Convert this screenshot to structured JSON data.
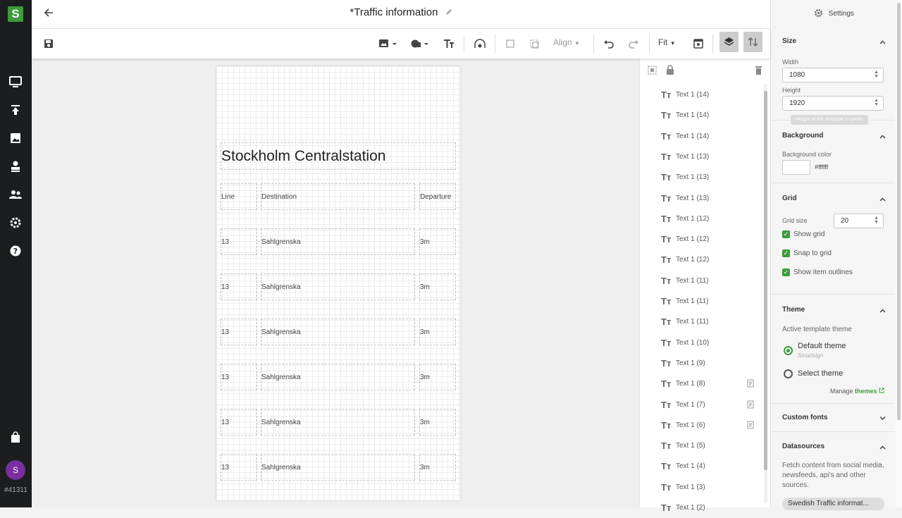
{
  "app": {
    "logo": "S",
    "user_initial": "S",
    "user_id": "#41311"
  },
  "header": {
    "title": "*Traffic information"
  },
  "toolbar": {
    "align_label": "Align",
    "zoom_label": "Fit"
  },
  "canvas": {
    "station": "Stockholm Centralstation",
    "headers": {
      "line": "Line",
      "destination": "Destination",
      "departure": "Departure"
    },
    "rows": [
      {
        "line": "13",
        "destination": "Sahlgrenska",
        "departure": "3m"
      },
      {
        "line": "13",
        "destination": "Sahlgrenska",
        "departure": "3m"
      },
      {
        "line": "13",
        "destination": "Sahlgrenska",
        "departure": "3m"
      },
      {
        "line": "13",
        "destination": "Sahlgrenska",
        "departure": "3m"
      },
      {
        "line": "13",
        "destination": "Sahlgrenska",
        "departure": "3m"
      },
      {
        "line": "13",
        "destination": "Sahlgrenska",
        "departure": "3m"
      }
    ]
  },
  "layers": {
    "glyph": "Tт",
    "items": [
      {
        "label": "Text 1 (14)"
      },
      {
        "label": "Text 1 (14)"
      },
      {
        "label": "Text 1 (14)"
      },
      {
        "label": "Text 1 (13)"
      },
      {
        "label": "Text 1 (13)"
      },
      {
        "label": "Text 1 (13)"
      },
      {
        "label": "Text 1 (12)"
      },
      {
        "label": "Text 1 (12)"
      },
      {
        "label": "Text 1 (12)"
      },
      {
        "label": "Text 1 (11)"
      },
      {
        "label": "Text 1 (11)"
      },
      {
        "label": "Text 1 (11)"
      },
      {
        "label": "Text 1 (10)"
      },
      {
        "label": "Text 1 (9)"
      },
      {
        "label": "Text 1 (8)",
        "datasource": true
      },
      {
        "label": "Text 1 (7)",
        "datasource": true
      },
      {
        "label": "Text 1 (6)",
        "datasource": true
      },
      {
        "label": "Text 1 (5)"
      },
      {
        "label": "Text 1 (4)"
      },
      {
        "label": "Text 1 (3)"
      },
      {
        "label": "Text 1 (2)"
      }
    ]
  },
  "settings": {
    "title": "Settings",
    "size": {
      "title": "Size",
      "width_label": "Width",
      "width_value": "1080",
      "height_label": "Height",
      "height_value": "1920",
      "height_tooltip": "Height of the template in pixels"
    },
    "background": {
      "title": "Background",
      "color_label": "Background color",
      "color_value": "#ffffff"
    },
    "grid": {
      "title": "Grid",
      "size_label": "Grid size",
      "size_value": "20",
      "show_grid": "Show grid",
      "snap": "Snap to grid",
      "outlines": "Show item outlines"
    },
    "theme": {
      "title": "Theme",
      "active_label": "Active template theme",
      "default_theme": "Default theme",
      "default_sub": "Smartsign",
      "select_theme": "Select theme",
      "manage_prefix": "Manage",
      "manage_link": "themes"
    },
    "custom_fonts": {
      "title": "Custom fonts"
    },
    "datasources": {
      "title": "Datasources",
      "description": "Fetch content from social media, newsfeeds, api's and other sources.",
      "chip": "Swedish Traffic informat..."
    }
  },
  "colors": {
    "accent": "#3a9c3a",
    "rail": "#1b1d1e",
    "avatar": "#7b2f9e"
  }
}
